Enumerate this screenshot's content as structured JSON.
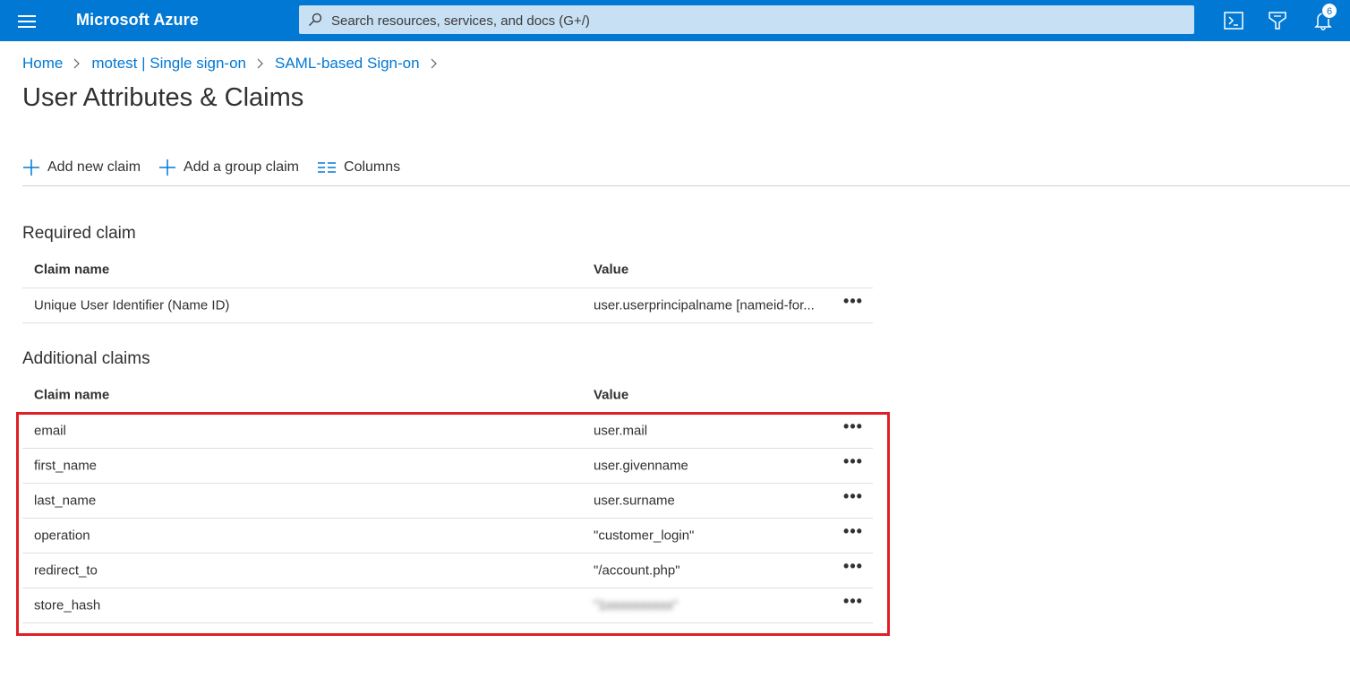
{
  "topbar": {
    "brand": "Microsoft Azure",
    "search_placeholder": "Search resources, services, and docs (G+/)",
    "notification_count": "6",
    "accent": "#0078d4"
  },
  "breadcrumb": [
    "Home",
    "motest | Single sign-on",
    "SAML-based Sign-on"
  ],
  "page_title": "User Attributes & Claims",
  "toolbar": {
    "add_new_claim": "Add new claim",
    "add_group_claim": "Add a group claim",
    "columns": "Columns"
  },
  "required": {
    "title": "Required claim",
    "headers": [
      "Claim name",
      "Value"
    ],
    "rows": [
      {
        "name": "Unique User Identifier (Name ID)",
        "value": "user.userprincipalname [nameid-for..."
      }
    ]
  },
  "additional": {
    "title": "Additional claims",
    "headers": [
      "Claim name",
      "Value"
    ],
    "rows": [
      {
        "name": "email",
        "value": "user.mail"
      },
      {
        "name": "first_name",
        "value": "user.givenname"
      },
      {
        "name": "last_name",
        "value": "user.surname"
      },
      {
        "name": "operation",
        "value": "\"customer_login\""
      },
      {
        "name": "redirect_to",
        "value": "\"/account.php\""
      },
      {
        "name": "store_hash",
        "value": "\"1xxxxxxxxxx\""
      }
    ]
  },
  "more_label": "•••",
  "highlight_color": "#e01f26"
}
